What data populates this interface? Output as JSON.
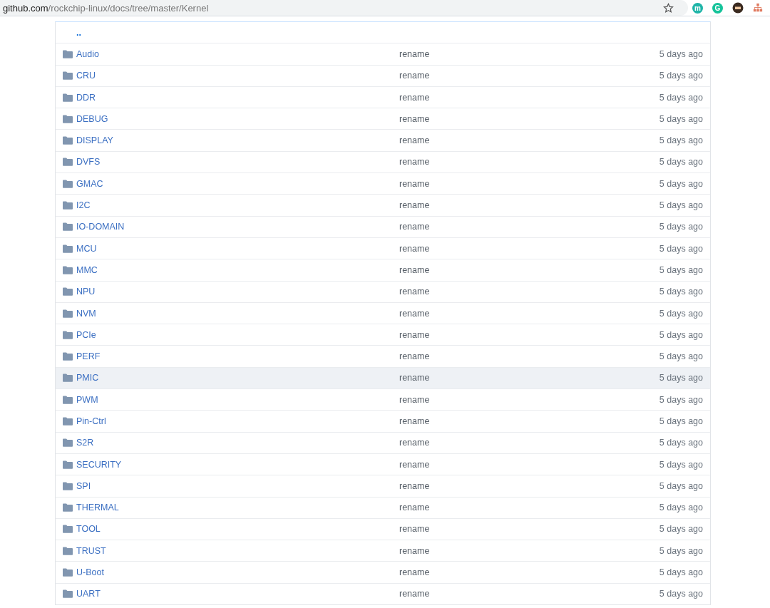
{
  "address_bar": {
    "host": "github.com",
    "path": "/rockchip-linux/docs/tree/master/Kernel"
  },
  "extensions": [
    {
      "kind": "m",
      "label": "m",
      "color": "#1fb5a8"
    },
    {
      "kind": "g",
      "label": "G",
      "color": "#15c39a"
    },
    {
      "kind": "face",
      "color": "#3a2a20"
    },
    {
      "kind": "tree",
      "color": "#e07a5f"
    }
  ],
  "parent_link": "..",
  "rows": [
    {
      "name": "Audio",
      "message": "rename",
      "age": "5 days ago",
      "selected": false
    },
    {
      "name": "CRU",
      "message": "rename",
      "age": "5 days ago",
      "selected": false
    },
    {
      "name": "DDR",
      "message": "rename",
      "age": "5 days ago",
      "selected": false
    },
    {
      "name": "DEBUG",
      "message": "rename",
      "age": "5 days ago",
      "selected": false
    },
    {
      "name": "DISPLAY",
      "message": "rename",
      "age": "5 days ago",
      "selected": false
    },
    {
      "name": "DVFS",
      "message": "rename",
      "age": "5 days ago",
      "selected": false
    },
    {
      "name": "GMAC",
      "message": "rename",
      "age": "5 days ago",
      "selected": false
    },
    {
      "name": "I2C",
      "message": "rename",
      "age": "5 days ago",
      "selected": false
    },
    {
      "name": "IO-DOMAIN",
      "message": "rename",
      "age": "5 days ago",
      "selected": false
    },
    {
      "name": "MCU",
      "message": "rename",
      "age": "5 days ago",
      "selected": false
    },
    {
      "name": "MMC",
      "message": "rename",
      "age": "5 days ago",
      "selected": false
    },
    {
      "name": "NPU",
      "message": "rename",
      "age": "5 days ago",
      "selected": false
    },
    {
      "name": "NVM",
      "message": "rename",
      "age": "5 days ago",
      "selected": false
    },
    {
      "name": "PCIe",
      "message": "rename",
      "age": "5 days ago",
      "selected": false
    },
    {
      "name": "PERF",
      "message": "rename",
      "age": "5 days ago",
      "selected": false
    },
    {
      "name": "PMIC",
      "message": "rename",
      "age": "5 days ago",
      "selected": true
    },
    {
      "name": "PWM",
      "message": "rename",
      "age": "5 days ago",
      "selected": false
    },
    {
      "name": "Pin-Ctrl",
      "message": "rename",
      "age": "5 days ago",
      "selected": false
    },
    {
      "name": "S2R",
      "message": "rename",
      "age": "5 days ago",
      "selected": false
    },
    {
      "name": "SECURITY",
      "message": "rename",
      "age": "5 days ago",
      "selected": false
    },
    {
      "name": "SPI",
      "message": "rename",
      "age": "5 days ago",
      "selected": false
    },
    {
      "name": "THERMAL",
      "message": "rename",
      "age": "5 days ago",
      "selected": false
    },
    {
      "name": "TOOL",
      "message": "rename",
      "age": "5 days ago",
      "selected": false
    },
    {
      "name": "TRUST",
      "message": "rename",
      "age": "5 days ago",
      "selected": false
    },
    {
      "name": "U-Boot",
      "message": "rename",
      "age": "5 days ago",
      "selected": false
    },
    {
      "name": "UART",
      "message": "rename",
      "age": "5 days ago",
      "selected": false
    }
  ]
}
